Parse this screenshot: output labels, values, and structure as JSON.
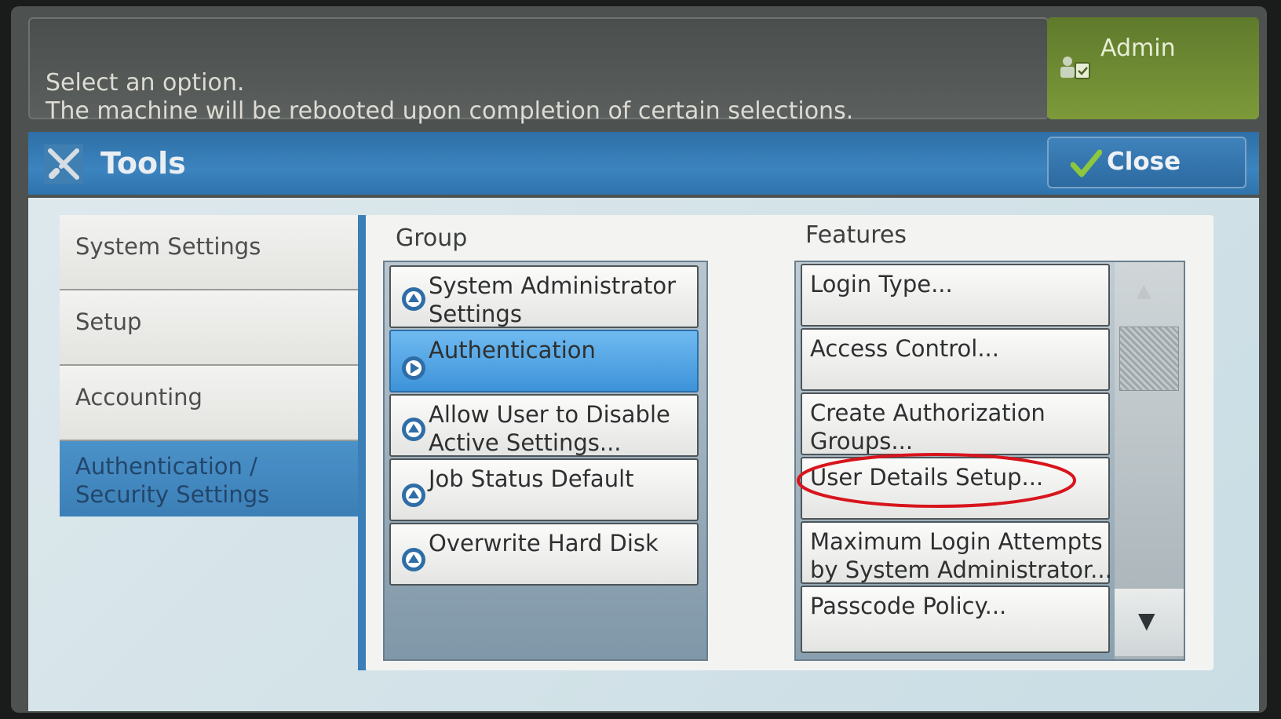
{
  "message": {
    "line1": "Select an option.",
    "line2": "The machine will be rebooted upon completion of certain selections."
  },
  "admin": {
    "label": "Admin",
    "icon": "admin-user-icon"
  },
  "title": {
    "label": "Tools",
    "icon": "tools-icon"
  },
  "close": {
    "label": "Close",
    "icon": "checkmark-icon"
  },
  "nav": {
    "items": [
      {
        "label": "System Settings"
      },
      {
        "label": "Setup"
      },
      {
        "label": "Accounting"
      },
      {
        "label_line1": "Authentication /",
        "label_line2": "Security Settings",
        "selected": true
      }
    ]
  },
  "group": {
    "header": "Group",
    "items": [
      {
        "line1": "System Administrator",
        "line2": "Settings"
      },
      {
        "line1": "Authentication",
        "line2": "",
        "selected": true
      },
      {
        "line1": "Allow User to Disable",
        "line2": "Active Settings..."
      },
      {
        "line1": "Job Status Default",
        "line2": ""
      },
      {
        "line1": "Overwrite Hard Disk",
        "line2": ""
      }
    ]
  },
  "features": {
    "header": "Features",
    "items": [
      {
        "line1": "Login Type...",
        "line2": ""
      },
      {
        "line1": "Access Control...",
        "line2": ""
      },
      {
        "line1": "Create Authorization",
        "line2": "Groups..."
      },
      {
        "line1": "User Details Setup...",
        "line2": "",
        "highlighted": true
      },
      {
        "line1": "Maximum Login Attempts",
        "line2": "by System Administrator..."
      },
      {
        "line1": "Passcode Policy...",
        "line2": ""
      }
    ]
  },
  "scroll": {
    "up_icon": "scroll-up-icon",
    "down_icon": "scroll-down-icon",
    "up": "▲",
    "down": "▼"
  },
  "colors": {
    "highlight_circle": "#d8141c",
    "selected_blue": "#3d93d9",
    "admin_green": "#7d9a3a"
  }
}
